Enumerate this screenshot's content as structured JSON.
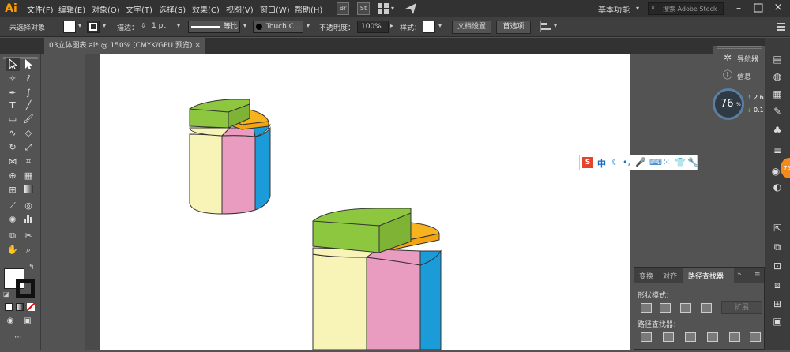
{
  "app": {
    "logo": "Ai"
  },
  "menubar": {
    "items": [
      "文件(F)",
      "编辑(E)",
      "对象(O)",
      "文字(T)",
      "选择(S)",
      "效果(C)",
      "视图(V)",
      "窗口(W)",
      "帮助(H)"
    ],
    "bridge": "Br",
    "stock": "St",
    "workspace": "基本功能",
    "search_placeholder": "搜索 Adobe Stock"
  },
  "control": {
    "no_selection": "未选择对象",
    "stroke_label": "描边：",
    "stroke_value": "1 pt",
    "profile": "等比",
    "brush": "Touch C...",
    "opacity_label": "不透明度：",
    "opacity_value": "100%",
    "style_label": "样式：",
    "doc_setup": "文档设置",
    "preferences": "首选项"
  },
  "tab": {
    "title": "03立体图表.ai* @ 150% (CMYK/GPU 预览)",
    "close": "×"
  },
  "right_dock": {
    "navigator": "导航器",
    "info": "信息"
  },
  "perf": {
    "percent": "76",
    "percent_unit": "%",
    "up": "2.6",
    "down": "0.1",
    "unit": "K/s"
  },
  "side_badge": "76",
  "ime": {
    "logo": "S",
    "mode": "中"
  },
  "pathfinder": {
    "tabs": [
      "变换",
      "对齐",
      "路径查找器"
    ],
    "shape_modes": "形状模式：",
    "expand": "扩展",
    "pathfinders": "路径查找器："
  },
  "colors": {
    "green": "#8dc63f",
    "orange": "#f7b31d",
    "blue": "#1b9bd7",
    "pink": "#e99bc0",
    "cream": "#f8f4b8",
    "accent": "#ff9a00"
  }
}
